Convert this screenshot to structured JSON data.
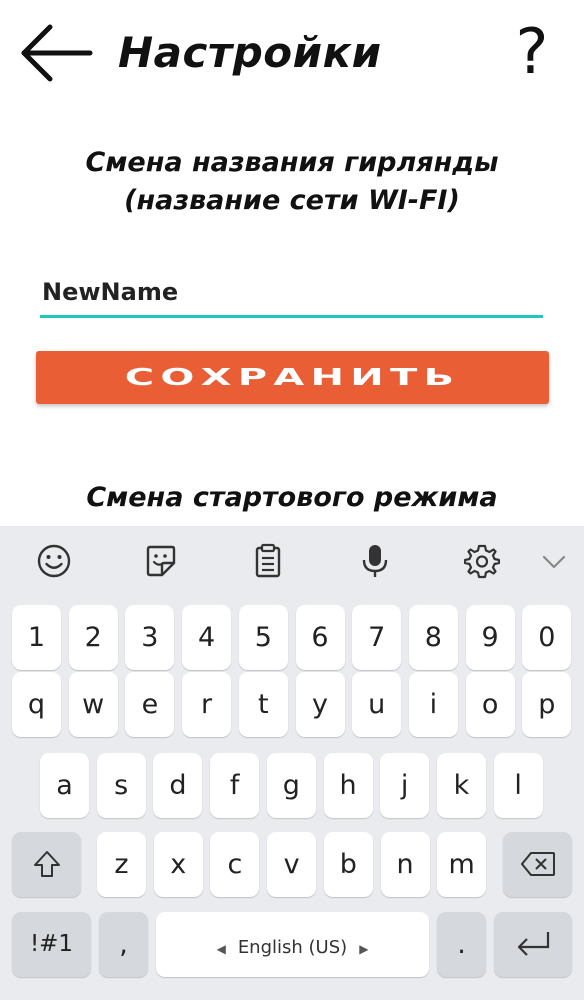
{
  "header": {
    "title": "Настройки",
    "help_label": "?"
  },
  "rename_section": {
    "title_line1": "Смена названия гирлянды",
    "title_line2": "(название сети WI-FI)",
    "input_value": "NewName",
    "save_label": "СОХРАНИТЬ"
  },
  "start_mode_section": {
    "title": "Смена стартового режима"
  },
  "keyboard": {
    "toolbar_icons": [
      "emoji-icon",
      "sticker-icon",
      "clipboard-icon",
      "microphone-icon",
      "settings-icon",
      "chevron-down-icon"
    ],
    "row_numbers": [
      "1",
      "2",
      "3",
      "4",
      "5",
      "6",
      "7",
      "8",
      "9",
      "0"
    ],
    "row_1": [
      "q",
      "w",
      "e",
      "r",
      "t",
      "y",
      "u",
      "i",
      "o",
      "p"
    ],
    "row_2": [
      "a",
      "s",
      "d",
      "f",
      "g",
      "h",
      "j",
      "k",
      "l"
    ],
    "row_3": [
      "z",
      "x",
      "c",
      "v",
      "b",
      "n",
      "m"
    ],
    "symbols_label": "!#1",
    "comma_label": ",",
    "space_label": "English (US)",
    "period_label": "."
  }
}
